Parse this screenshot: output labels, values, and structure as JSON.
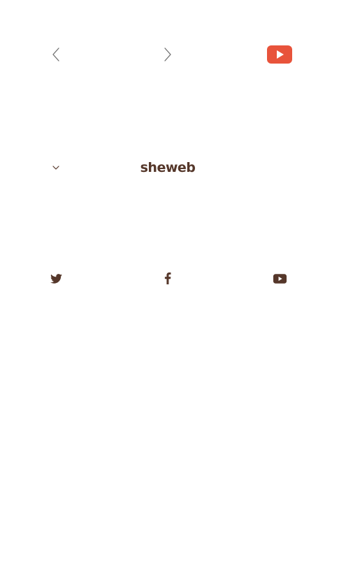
{
  "header": {
    "prev_icon": "chevron-left-icon",
    "next_icon": "chevron-right-icon",
    "video_icon": "youtube-play-icon"
  },
  "brand": {
    "logo_text": "sheweb",
    "menu_icon": "chevron-down-icon"
  },
  "social": {
    "items": [
      {
        "icon": "twitter-icon"
      },
      {
        "icon": "facebook-icon"
      },
      {
        "icon": "youtube-icon"
      }
    ]
  },
  "colors": {
    "brand": "#55372a",
    "youtube_red": "#e8533b",
    "icon_gray": "#7a7a7a"
  }
}
